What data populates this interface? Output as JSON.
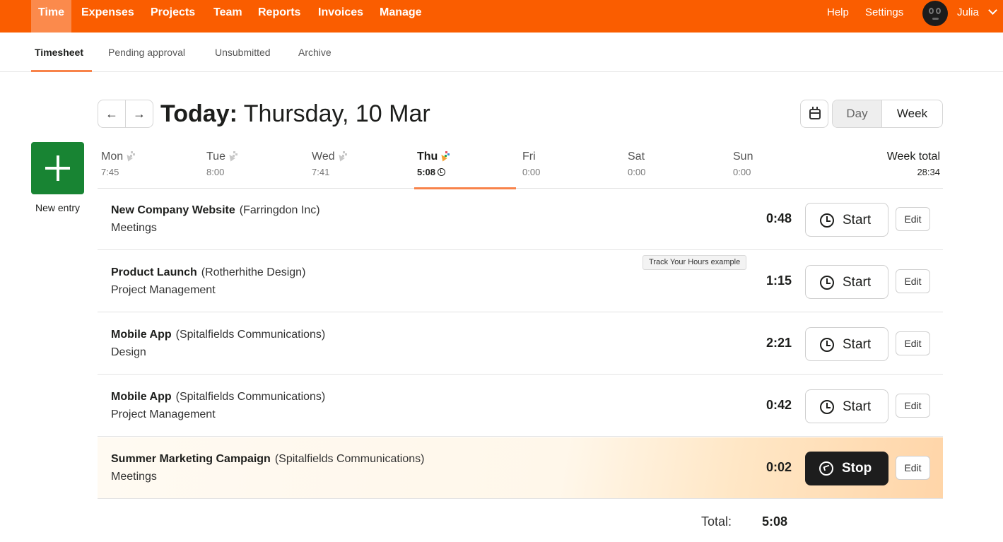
{
  "topnav": {
    "items": [
      "Time",
      "Expenses",
      "Projects",
      "Team",
      "Reports",
      "Invoices",
      "Manage"
    ],
    "help": "Help",
    "settings": "Settings",
    "user": "Julia",
    "brand_color": "#fa5d00"
  },
  "subnav": {
    "items": [
      "Timesheet",
      "Pending approval",
      "Unsubmitted",
      "Archive"
    ]
  },
  "header": {
    "title_bold": "Today:",
    "title_rest": " Thursday, 10 Mar",
    "view_day": "Day",
    "view_week": "Week"
  },
  "new_entry": {
    "label": "New entry"
  },
  "week": {
    "days": [
      {
        "name": "Mon",
        "hours": "7:45"
      },
      {
        "name": "Tue",
        "hours": "8:00"
      },
      {
        "name": "Wed",
        "hours": "7:41"
      },
      {
        "name": "Thu",
        "hours": "5:08"
      },
      {
        "name": "Fri",
        "hours": "0:00"
      },
      {
        "name": "Sat",
        "hours": "0:00"
      },
      {
        "name": "Sun",
        "hours": "0:00"
      }
    ],
    "total_label": "Week total",
    "total_hours": "28:34"
  },
  "entries": [
    {
      "project": "New Company Website",
      "client": "(Farringdon Inc)",
      "task": "Meetings",
      "hours": "0:48",
      "action": "Start",
      "edit": "Edit"
    },
    {
      "project": "Product Launch",
      "client": "(Rotherhithe Design)",
      "task": "Project Management",
      "hours": "1:15",
      "action": "Start",
      "edit": "Edit"
    },
    {
      "project": "Mobile App",
      "client": "(Spitalfields Communications)",
      "task": "Design",
      "hours": "2:21",
      "action": "Start",
      "edit": "Edit"
    },
    {
      "project": "Mobile App",
      "client": "(Spitalfields Communications)",
      "task": "Project Management",
      "hours": "0:42",
      "action": "Start",
      "edit": "Edit"
    },
    {
      "project": "Summer Marketing Campaign",
      "client": "(Spitalfields Communications)",
      "task": "Meetings",
      "hours": "0:02",
      "action": "Stop",
      "edit": "Edit"
    }
  ],
  "tooltip": "Track Your Hours example",
  "footer": {
    "total_label": "Total:",
    "total_value": "5:08"
  }
}
